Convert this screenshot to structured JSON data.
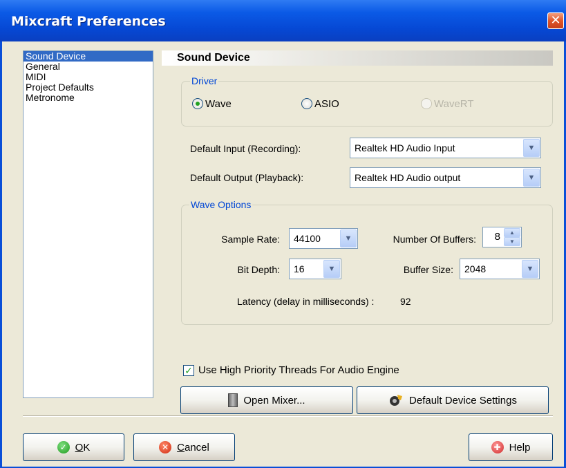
{
  "window": {
    "title": "Mixcraft Preferences",
    "close_label": "✕"
  },
  "categories": [
    "Sound Device",
    "General",
    "MIDI",
    "Project Defaults",
    "Metronome"
  ],
  "section_title": "Sound Device",
  "driver": {
    "label": "Driver",
    "options": [
      {
        "label": "Wave",
        "checked": true,
        "disabled": false
      },
      {
        "label": "ASIO",
        "checked": false,
        "disabled": false
      },
      {
        "label": "WaveRT",
        "checked": false,
        "disabled": true
      }
    ]
  },
  "default_input": {
    "label": "Default Input (Recording):",
    "value": "Realtek HD Audio Input"
  },
  "default_output": {
    "label": "Default Output (Playback):",
    "value": "Realtek HD Audio output"
  },
  "wave_options": {
    "label": "Wave Options",
    "sample_rate": {
      "label": "Sample Rate:",
      "value": "44100"
    },
    "num_buffers": {
      "label": "Number Of Buffers:",
      "value": "8"
    },
    "bit_depth": {
      "label": "Bit Depth:",
      "value": "16"
    },
    "buffer_size": {
      "label": "Buffer Size:",
      "value": "2048"
    },
    "latency": {
      "label": "Latency (delay in milliseconds) :",
      "value": "92"
    }
  },
  "high_priority": {
    "label": "Use High Priority Threads For Audio Engine",
    "checked": true
  },
  "buttons": {
    "open_mixer": "Open Mixer...",
    "default_device_settings": "Default Device Settings",
    "ok_rest": "K",
    "ok_mnemonic": "O",
    "cancel_mnemonic": "C",
    "cancel_rest": "ancel",
    "help": "Help"
  },
  "icons": {
    "combo_arrow": "chevron-down-icon",
    "ok": "check-circle-icon",
    "cancel": "x-circle-icon",
    "help": "lifebuoy-icon",
    "mixer": "mixer-icon",
    "settings": "speaker-settings-icon"
  },
  "colors": {
    "titlebar": "#0a4fd8",
    "selection": "#316ac5",
    "group_label": "#0046d5",
    "dialog_bg": "#ece9d8"
  }
}
